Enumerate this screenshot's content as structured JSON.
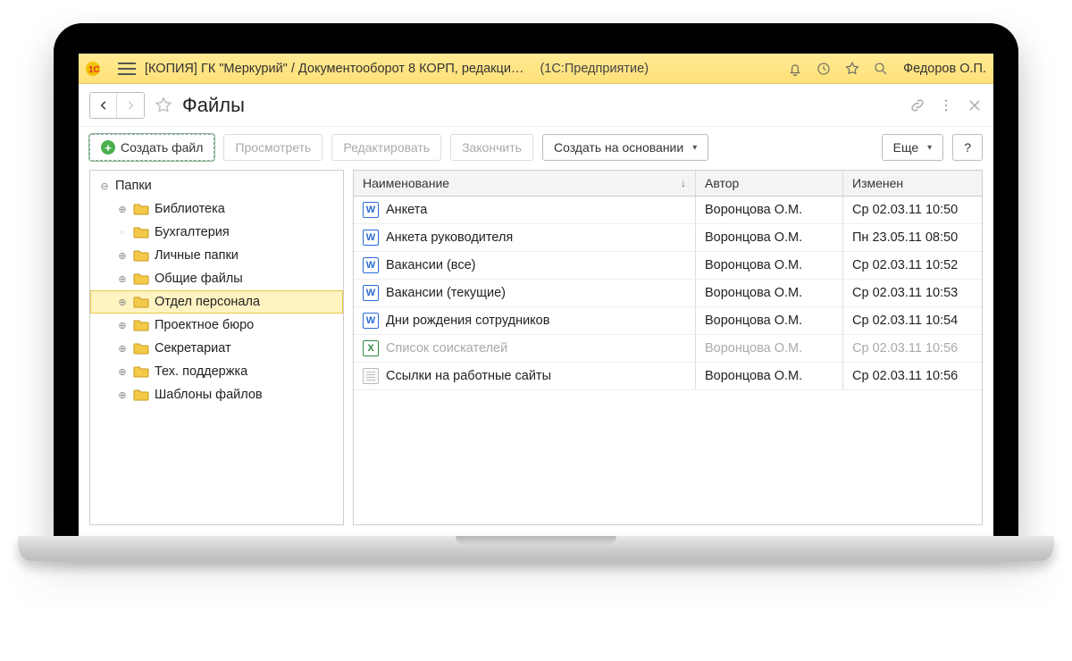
{
  "titlebar": {
    "title_main": "[КОПИЯ] ГК \"Меркурий\" / Документооборот 8 КОРП, редакци…",
    "title_sub": "(1С:Предприятие)",
    "user_name": "Федоров О.П."
  },
  "page": {
    "title": "Файлы"
  },
  "toolbar": {
    "create_file": "Создать файл",
    "view": "Просмотреть",
    "edit": "Редактировать",
    "finish": "Закончить",
    "create_based_on": "Создать на основании",
    "more": "Еще",
    "help": "?"
  },
  "tree": {
    "root": "Папки",
    "items": [
      {
        "label": "Библиотека",
        "exp": "plus"
      },
      {
        "label": "Бухгалтерия",
        "exp": "dot"
      },
      {
        "label": "Личные папки",
        "exp": "plus"
      },
      {
        "label": "Общие файлы",
        "exp": "plus"
      },
      {
        "label": "Отдел персонала",
        "exp": "plus",
        "selected": true
      },
      {
        "label": "Проектное бюро",
        "exp": "plus"
      },
      {
        "label": "Секретариат",
        "exp": "plus"
      },
      {
        "label": "Тех. поддержка",
        "exp": "plus"
      },
      {
        "label": "Шаблоны файлов",
        "exp": "plus"
      }
    ]
  },
  "grid": {
    "columns": {
      "name": "Наименование",
      "author": "Автор",
      "modified": "Изменен"
    },
    "rows": [
      {
        "icon": "word",
        "name": "Анкета",
        "author": "Воронцова О.М.",
        "modified": "Ср 02.03.11 10:50"
      },
      {
        "icon": "word",
        "name": "Анкета руководителя",
        "author": "Воронцова О.М.",
        "modified": "Пн 23.05.11 08:50"
      },
      {
        "icon": "word",
        "name": "Вакансии (все)",
        "author": "Воронцова О.М.",
        "modified": "Ср 02.03.11 10:52"
      },
      {
        "icon": "word",
        "name": "Вакансии (текущие)",
        "author": "Воронцова О.М.",
        "modified": "Ср 02.03.11 10:53"
      },
      {
        "icon": "word",
        "name": "Дни рождения сотрудников",
        "author": "Воронцова О.М.",
        "modified": "Ср 02.03.11 10:54"
      },
      {
        "icon": "excel",
        "name": "Список соискателей",
        "author": "Воронцова О.М.",
        "modified": "Ср 02.03.11 10:56",
        "dim": true
      },
      {
        "icon": "txt",
        "name": "Ссылки на работные сайты",
        "author": "Воронцова О.М.",
        "modified": "Ср 02.03.11 10:56"
      }
    ]
  }
}
